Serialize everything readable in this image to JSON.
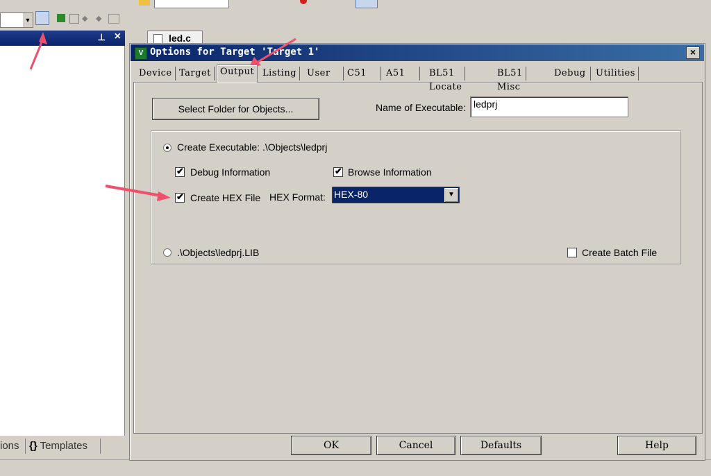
{
  "ide": {
    "project_tabs": {
      "functions_partial": "ions",
      "templates": "Templates"
    },
    "editor_tab": "led.c"
  },
  "dialog": {
    "title": "Options for Target 'Target 1'",
    "close_glyph": "×",
    "tabs": [
      {
        "label": "Device",
        "selected": false
      },
      {
        "label": "Target",
        "selected": false
      },
      {
        "label": "Output",
        "selected": true
      },
      {
        "label": "Listing",
        "selected": false
      },
      {
        "label": "User",
        "selected": false
      },
      {
        "label": "C51",
        "selected": false
      },
      {
        "label": "A51",
        "selected": false
      },
      {
        "label": "BL51 Locate",
        "selected": false
      },
      {
        "label": "BL51 Misc",
        "selected": false
      },
      {
        "label": "Debug",
        "selected": false
      },
      {
        "label": "Utilities",
        "selected": false
      }
    ],
    "output": {
      "select_folder_button": "Select Folder for Objects...",
      "name_of_executable_label": "Name of Executable:",
      "name_of_executable_value": "ledprj",
      "create_executable_label": "Create Executable:  .\\Objects\\ledprj",
      "create_executable_selected": true,
      "debug_info_label": "Debug Information",
      "debug_info_checked": true,
      "browse_info_label": "Browse Information",
      "browse_info_checked": true,
      "create_hex_label": "Create HEX File",
      "create_hex_checked": true,
      "hex_format_label": "HEX Format:",
      "hex_format_value": "HEX-80",
      "library_label": ".\\Objects\\ledprj.LIB",
      "library_selected": false,
      "create_batch_label": "Create Batch File",
      "create_batch_checked": false
    },
    "buttons": {
      "ok": "OK",
      "cancel": "Cancel",
      "defaults": "Defaults",
      "help": "Help"
    }
  },
  "colors": {
    "face": "#d4d0c8",
    "title_dark": "#0a246a",
    "title_light": "#3a6ea5",
    "annotation_arrow": "#f0506a"
  }
}
